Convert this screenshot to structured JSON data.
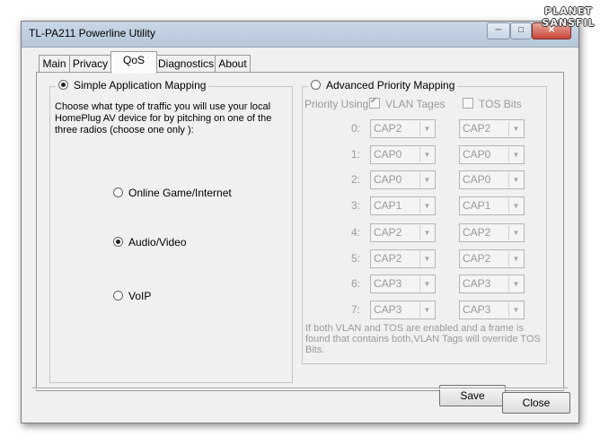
{
  "window": {
    "title": "TL-PA211 Powerline Utility"
  },
  "logo": {
    "line1": "PLANET",
    "line2": "SANSFIL"
  },
  "tabs": [
    {
      "label": "Main",
      "active": false
    },
    {
      "label": "Privacy",
      "active": false
    },
    {
      "label": "QoS",
      "active": true
    },
    {
      "label": "Diagnostics",
      "active": false
    },
    {
      "label": "About",
      "active": false
    }
  ],
  "simple": {
    "legend": "Simple Application Mapping",
    "selected": true,
    "description": "Choose what type of traffic you will use your local HomePlug AV device for by pitching on one of the three radios (choose one only ):",
    "options": [
      {
        "label": "Online Game/Internet",
        "selected": false
      },
      {
        "label": "Audio/Video",
        "selected": true
      },
      {
        "label": "VoIP",
        "selected": false
      }
    ]
  },
  "advanced": {
    "legend": "Advanced Priority Mapping",
    "selected": false,
    "priority_label": "Priority Using:",
    "vlan_label": "VLAN Tages",
    "vlan_checked": true,
    "tos_label": "TOS Bits",
    "tos_checked": false,
    "rows": [
      {
        "label": "0:",
        "vlan": "CAP2",
        "tos": "CAP2"
      },
      {
        "label": "1:",
        "vlan": "CAP0",
        "tos": "CAP0"
      },
      {
        "label": "2:",
        "vlan": "CAP0",
        "tos": "CAP0"
      },
      {
        "label": "3:",
        "vlan": "CAP1",
        "tos": "CAP1"
      },
      {
        "label": "4:",
        "vlan": "CAP2",
        "tos": "CAP2"
      },
      {
        "label": "5:",
        "vlan": "CAP2",
        "tos": "CAP2"
      },
      {
        "label": "6:",
        "vlan": "CAP3",
        "tos": "CAP3"
      },
      {
        "label": "7:",
        "vlan": "CAP3",
        "tos": "CAP3"
      }
    ],
    "note": "If both VLAN and TOS are enabled and a frame is found that contains both,VLAN Tags will override TOS Bits."
  },
  "buttons": {
    "save": "Save",
    "close": "Close"
  }
}
